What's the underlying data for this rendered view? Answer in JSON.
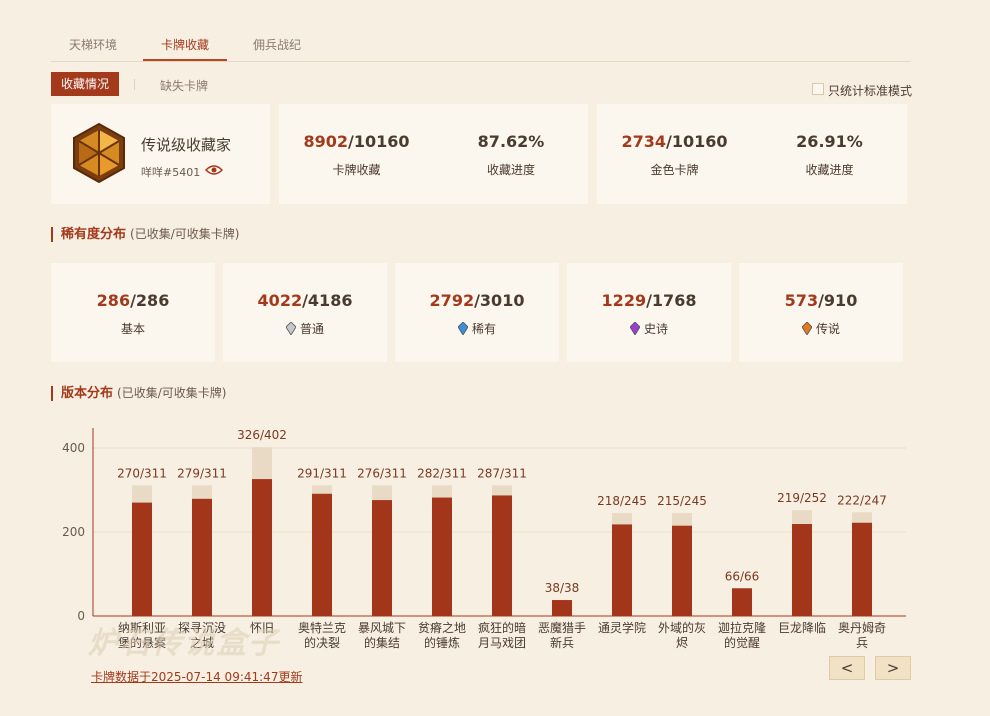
{
  "tabs": [
    {
      "label": "天梯环境",
      "active": false
    },
    {
      "label": "卡牌收藏",
      "active": true
    },
    {
      "label": "佣兵战纪",
      "active": false
    }
  ],
  "subtabs": {
    "active": "收藏情况",
    "other": "缺失卡牌"
  },
  "standard_mode": {
    "label": "只统计标准模式",
    "checked": false
  },
  "profile": {
    "title": "传说级收藏家",
    "id": "咩咩#5401",
    "icon": "eye-icon"
  },
  "collection": {
    "owned": "8902",
    "total": "/10160",
    "label": "卡牌收藏",
    "percent": "87.62%",
    "percent_label": "收藏进度"
  },
  "golden": {
    "owned": "2734",
    "total": "/10160",
    "label": "金色卡牌",
    "percent": "26.91%",
    "percent_label": "收藏进度"
  },
  "rarity": {
    "title": "稀有度分布",
    "subtitle": "(已收集/可收集卡牌)",
    "items": [
      {
        "owned": "286",
        "total": "/286",
        "label": "基本",
        "gem": ""
      },
      {
        "owned": "4022",
        "total": "/4186",
        "label": "普通",
        "gem": "#c7c7c7"
      },
      {
        "owned": "2792",
        "total": "/3010",
        "label": "稀有",
        "gem": "#3f8fd8"
      },
      {
        "owned": "1229",
        "total": "/1768",
        "label": "史诗",
        "gem": "#9a3fd0"
      },
      {
        "owned": "573",
        "total": "/910",
        "label": "传说",
        "gem": "#e07a1a"
      }
    ]
  },
  "expansions": {
    "title": "版本分布",
    "subtitle": "(已收集/可收集卡牌)"
  },
  "chart_data": {
    "type": "bar",
    "categories": [
      [
        "纳斯利亚",
        "堡的悬案"
      ],
      [
        "探寻沉没",
        "之城"
      ],
      [
        "怀旧"
      ],
      [
        "奥特兰克",
        "的决裂"
      ],
      [
        "暴风城下",
        "的集结"
      ],
      [
        "贫瘠之地",
        "的锤炼"
      ],
      [
        "疯狂的暗",
        "月马戏团"
      ],
      [
        "恶魔猎手",
        "新兵"
      ],
      [
        "通灵学院"
      ],
      [
        "外域的灰",
        "烬"
      ],
      [
        "迦拉克隆",
        "的觉醒"
      ],
      [
        "巨龙降临"
      ],
      [
        "奥丹姆奇",
        "兵"
      ]
    ],
    "series": [
      {
        "name": "",
        "values": [
          270,
          279,
          326,
          291,
          276,
          282,
          287,
          38,
          218,
          215,
          66,
          219,
          222
        ]
      },
      {
        "name": "",
        "values": [
          311,
          311,
          402,
          311,
          311,
          311,
          311,
          38,
          245,
          245,
          66,
          252,
          247
        ]
      }
    ],
    "data_labels": [
      "270/311",
      "279/311",
      "326/402",
      "291/311",
      "276/311",
      "282/311",
      "287/311",
      "38/38",
      "218/245",
      "215/245",
      "66/66",
      "219/252",
      "222/247"
    ],
    "yticks": [
      "0",
      "200",
      "400"
    ],
    "ylim": [
      0,
      450
    ],
    "colors": {
      "owned": "#a3351a",
      "total": "#e8dac4"
    }
  },
  "updated": "卡牌数据于2025-07-14 09:41:47更新",
  "nav": {
    "prev": "<",
    "next": ">"
  },
  "watermark": "炉石传说盒子"
}
